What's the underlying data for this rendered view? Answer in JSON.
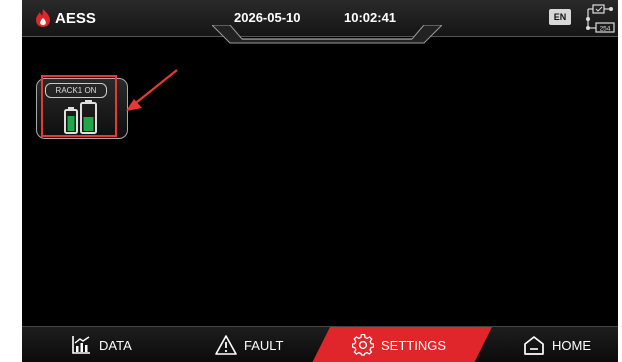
{
  "header": {
    "brand": "AESS",
    "date": "2026-05-10",
    "time": "10:02:41",
    "language_badge": "EN",
    "network_label": "254",
    "icons": [
      "flame-logo-icon",
      "network-topology-icon"
    ]
  },
  "main": {
    "rack_card": {
      "label": "RACK1 ON",
      "icon": "battery-rack-icon"
    },
    "annotation": {
      "highlight_color": "#e53935",
      "arrow_icon": "pointer-arrow-icon"
    }
  },
  "nav": {
    "items": [
      {
        "label": "DATA",
        "icon": "chart-icon"
      },
      {
        "label": "FAULT",
        "icon": "warning-icon"
      },
      {
        "label": "SETTINGS",
        "icon": "gear-icon",
        "active": true
      },
      {
        "label": "HOME",
        "icon": "home-icon"
      }
    ],
    "active_color": "#e1262b"
  },
  "colors": {
    "background": "#000000",
    "accent": "#e1262b",
    "battery_green": "#1fa84a"
  }
}
